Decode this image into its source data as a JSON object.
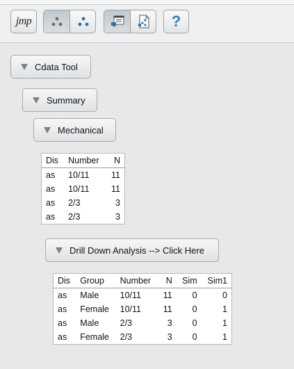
{
  "toolbar": {
    "logo_label": "jmp",
    "help_label": "?"
  },
  "outline": {
    "cdata_tool": "Cdata Tool",
    "summary": "Summary",
    "mechanical": "Mechanical",
    "drill_down": "Drill Down Analysis --> Click Here"
  },
  "table1": {
    "headers": [
      "Dis",
      "Number",
      "N"
    ],
    "rows": [
      [
        "as",
        "10/11",
        "11"
      ],
      [
        "as",
        "10/11",
        "11"
      ],
      [
        "as",
        "2/3",
        "3"
      ],
      [
        "as",
        "2/3",
        "3"
      ]
    ]
  },
  "table2": {
    "headers": [
      "Dis",
      "Group",
      "Number",
      "N",
      "Sim",
      "Sim1"
    ],
    "rows": [
      [
        "as",
        "Male",
        "10/11",
        "11",
        "0",
        "0"
      ],
      [
        "as",
        "Female",
        "10/11",
        "11",
        "0",
        "1"
      ],
      [
        "as",
        "Male",
        "2/3",
        "3",
        "0",
        "1"
      ],
      [
        "as",
        "Female",
        "2/3",
        "3",
        "0",
        "1"
      ]
    ]
  },
  "colors": {
    "background": "#e6e8ea",
    "help_blue": "#2f7fc4",
    "dot_blue": "#2f6fb0"
  }
}
